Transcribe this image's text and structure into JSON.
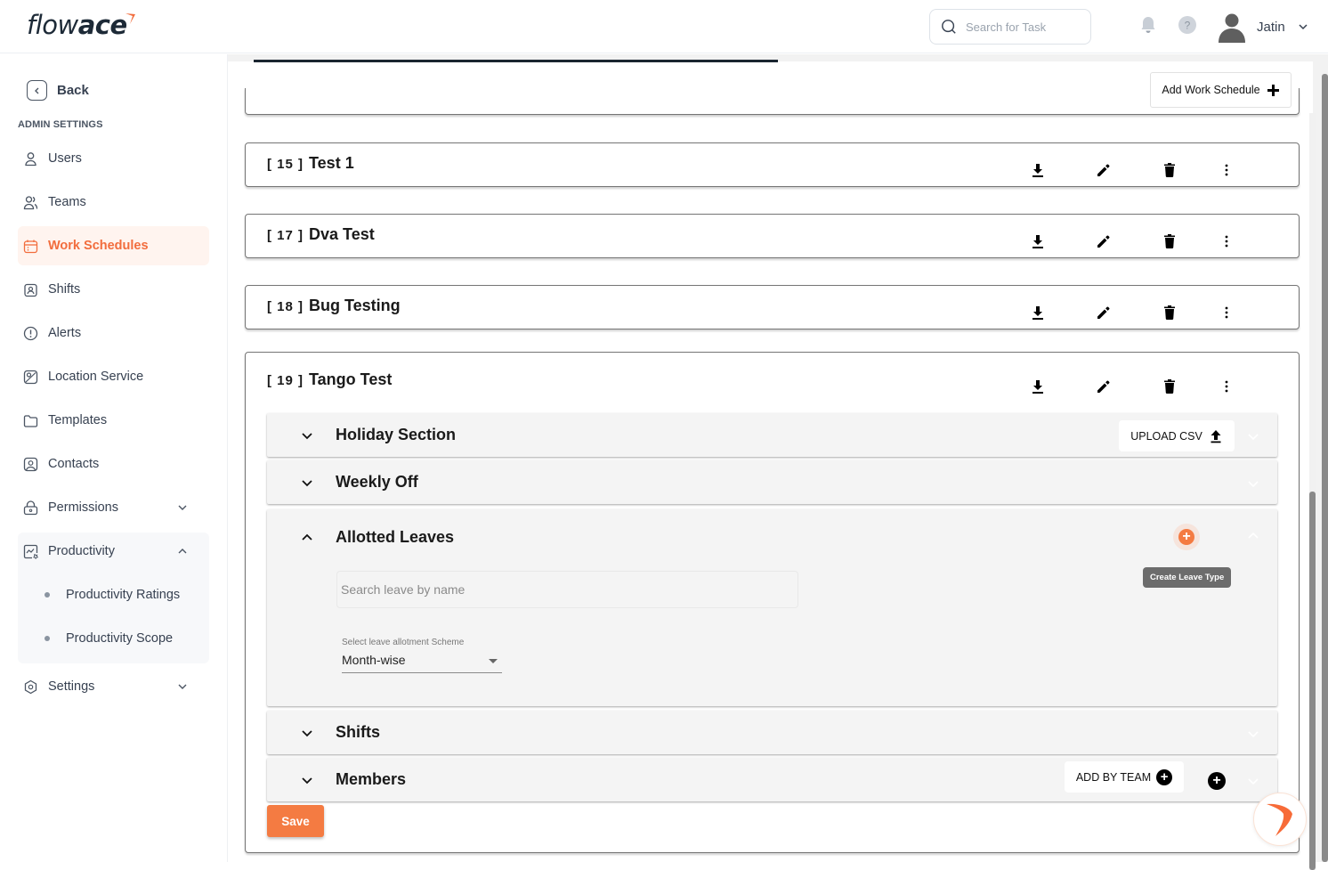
{
  "header": {
    "logo_light": "flow",
    "logo_bold": "ace",
    "search_placeholder": "Search for Task",
    "username": "Jatin"
  },
  "sidebar": {
    "back_label": "Back",
    "section_title": "ADMIN SETTINGS",
    "items": [
      {
        "label": "Users",
        "icon": "user-icon"
      },
      {
        "label": "Teams",
        "icon": "users-icon"
      },
      {
        "label": "Work Schedules",
        "icon": "calendar-icon",
        "active": true
      },
      {
        "label": "Shifts",
        "icon": "badge-icon"
      },
      {
        "label": "Alerts",
        "icon": "alert-circle-icon"
      },
      {
        "label": "Location Service",
        "icon": "map-pin-icon"
      },
      {
        "label": "Templates",
        "icon": "folder-icon"
      },
      {
        "label": "Contacts",
        "icon": "contact-icon"
      },
      {
        "label": "Permissions",
        "icon": "lock-icon",
        "expandable": true,
        "expanded": false
      },
      {
        "label": "Productivity",
        "icon": "chart-icon",
        "expandable": true,
        "expanded": true
      },
      {
        "label": "Settings",
        "icon": "settings-icon",
        "expandable": true,
        "expanded": false
      }
    ],
    "productivity_sub": [
      {
        "label": "Productivity Ratings"
      },
      {
        "label": "Productivity Scope"
      }
    ]
  },
  "main": {
    "add_work_schedule_label": "Add Work Schedule",
    "schedules": [
      {
        "id": "[ 15 ]",
        "name": "Test 1"
      },
      {
        "id": "[ 17 ]",
        "name": "Dva Test"
      },
      {
        "id": "[ 18 ]",
        "name": "Bug Testing"
      },
      {
        "id": "[ 19 ]",
        "name": "Tango Test"
      }
    ],
    "expanded": {
      "holiday_title": "Holiday Section",
      "upload_csv_label": "UPLOAD CSV",
      "weekly_off_title": "Weekly Off",
      "allotted_leaves_title": "Allotted Leaves",
      "create_leave_tooltip": "Create Leave Type",
      "leave_search_placeholder": "Search leave by name",
      "scheme_label": "Select leave allotment Scheme",
      "scheme_value": "Month-wise",
      "shifts_title": "Shifts",
      "members_title": "Members",
      "add_by_team_label": "ADD BY TEAM",
      "save_label": "Save"
    }
  },
  "colors": {
    "accent": "#f47b42",
    "active_nav_text": "#f26d3d",
    "active_nav_bg": "#fff4ef"
  }
}
